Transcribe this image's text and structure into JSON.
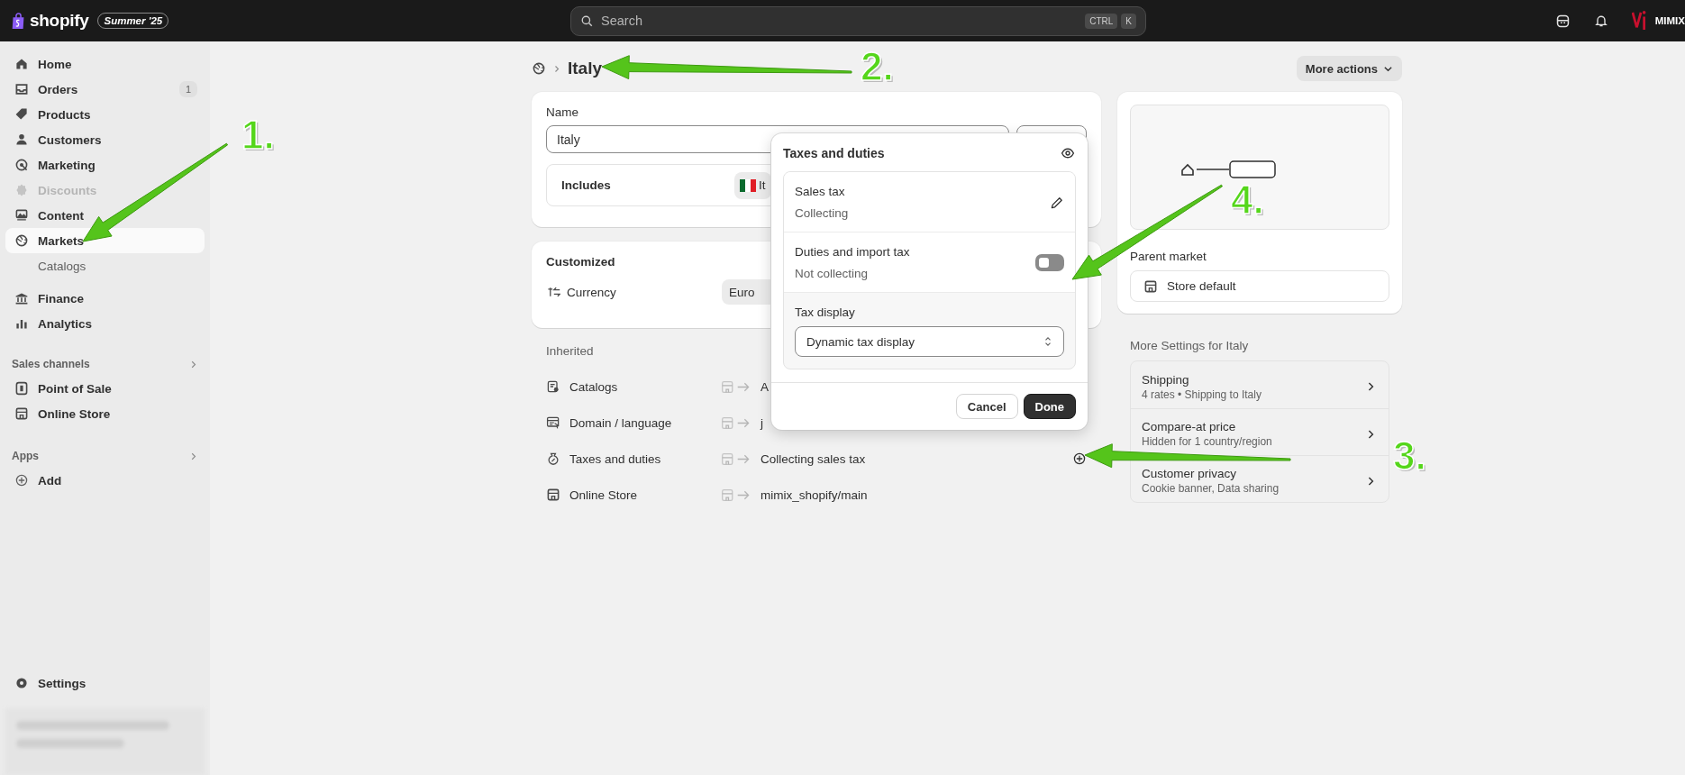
{
  "topbar": {
    "logo_text": "shopify",
    "edition_badge": "Summer '25",
    "search": {
      "placeholder": "Search",
      "shortcut_keys": [
        "CTRL",
        "K"
      ]
    },
    "account": "MIMIX"
  },
  "sidebar": {
    "nav": [
      {
        "label": "Home",
        "selected": false,
        "disabled": false
      },
      {
        "label": "Orders",
        "badge": "1",
        "selected": false,
        "disabled": false
      },
      {
        "label": "Products",
        "selected": false,
        "disabled": false
      },
      {
        "label": "Customers",
        "selected": false,
        "disabled": false
      },
      {
        "label": "Marketing",
        "selected": false,
        "disabled": false
      },
      {
        "label": "Discounts",
        "selected": false,
        "disabled": true
      },
      {
        "label": "Content",
        "selected": false,
        "disabled": false
      },
      {
        "label": "Markets",
        "selected": true,
        "disabled": false,
        "children": [
          {
            "label": "Catalogs",
            "selected": false
          }
        ]
      },
      {
        "label": "Finance",
        "selected": false,
        "disabled": false
      },
      {
        "label": "Analytics",
        "selected": false,
        "disabled": false
      }
    ],
    "sales_channels": {
      "title": "Sales channels",
      "items": [
        {
          "label": "Point of Sale"
        },
        {
          "label": "Online Store"
        }
      ]
    },
    "apps": {
      "title": "Apps",
      "items": [
        {
          "label": "Add"
        }
      ]
    },
    "settings": "Settings"
  },
  "header": {
    "title": "Italy",
    "more_actions": "More actions"
  },
  "name_card": {
    "label": "Name",
    "value": "Italy",
    "includes_label": "Includes",
    "includes_chip": "It"
  },
  "customized_card": {
    "title": "Customized",
    "currency_label": "Currency",
    "currency_value": "Euro"
  },
  "inherited": {
    "title": "Inherited",
    "rows": [
      {
        "label": "Catalogs",
        "value": "A",
        "has_action": false
      },
      {
        "label": "Domain / language",
        "value": "j",
        "has_action": false
      },
      {
        "label": "Taxes and duties",
        "value": "Collecting sales tax",
        "has_action": true
      },
      {
        "label": "Online Store",
        "value": "mimix_shopify/main",
        "has_action": false
      }
    ]
  },
  "popover": {
    "title": "Taxes and duties",
    "sections": [
      {
        "kind": "edit",
        "title": "Sales tax",
        "status": "Collecting"
      },
      {
        "kind": "toggle",
        "title": "Duties and import tax",
        "status": "Not collecting",
        "on": false
      }
    ],
    "tax_display": {
      "label": "Tax display",
      "value": "Dynamic tax display"
    },
    "cancel": "Cancel",
    "done": "Done"
  },
  "parent_card": {
    "label": "Parent market",
    "value": "Store default"
  },
  "more_settings": {
    "title": "More Settings for Italy",
    "items": [
      {
        "title": "Shipping",
        "subtitle": "4 rates • Shipping to Italy"
      },
      {
        "title": "Compare-at price",
        "subtitle": "Hidden for 1 country/region"
      },
      {
        "title": "Customer privacy",
        "subtitle": "Cookie banner, Data sharing"
      }
    ]
  },
  "annotations": [
    {
      "label": "1."
    },
    {
      "label": "2."
    },
    {
      "label": "3."
    },
    {
      "label": "4."
    }
  ]
}
